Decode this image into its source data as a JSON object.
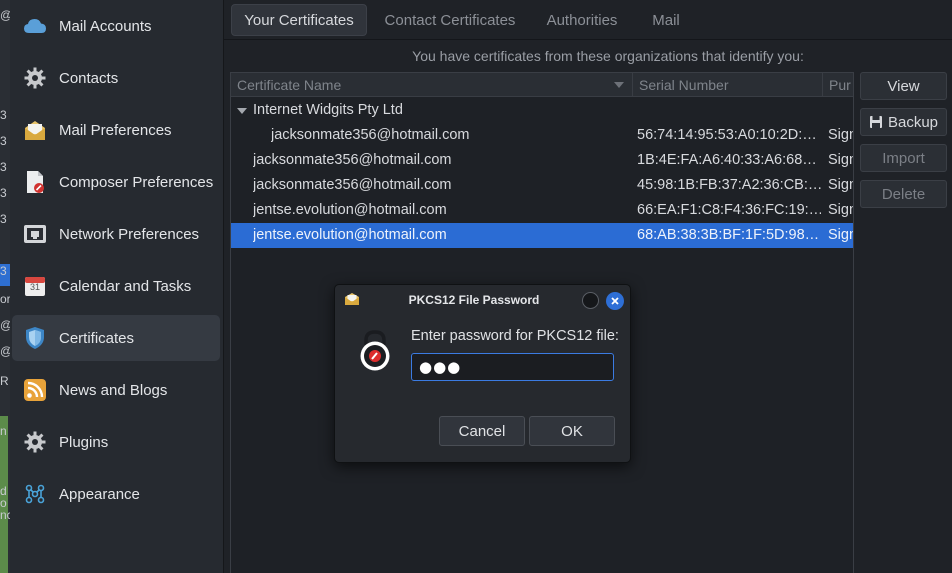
{
  "background_app": {
    "fragments": [
      "@",
      "3",
      "3",
      "3",
      "3",
      "3",
      "3",
      "or",
      "@",
      "@",
      "R",
      "n",
      "d",
      "o",
      "nc"
    ]
  },
  "sidebar": {
    "items": [
      {
        "label": "Mail Accounts",
        "icon": "cloud-icon"
      },
      {
        "label": "Contacts",
        "icon": "gear-icon"
      },
      {
        "label": "Mail Preferences",
        "icon": "envelope-icon"
      },
      {
        "label": "Composer Preferences",
        "icon": "document-edit-icon"
      },
      {
        "label": "Network Preferences",
        "icon": "network-icon"
      },
      {
        "label": "Calendar and Tasks",
        "icon": "calendar-icon",
        "calendar_day": "31"
      },
      {
        "label": "Certificates",
        "icon": "shield-icon",
        "active": true
      },
      {
        "label": "News and Blogs",
        "icon": "rss-icon"
      },
      {
        "label": "Plugins",
        "icon": "gear-icon"
      },
      {
        "label": "Appearance",
        "icon": "appearance-icon"
      }
    ]
  },
  "tabs": [
    {
      "label": "Your Certificates",
      "active": true
    },
    {
      "label": "Contact Certificates"
    },
    {
      "label": "Authorities"
    },
    {
      "label": "Mail"
    }
  ],
  "intro_text": "You have certificates from these organizations that identify you:",
  "table": {
    "columns": [
      "Certificate Name",
      "Serial Number",
      "Pur"
    ],
    "group": "Internet Widgits Pty Ltd",
    "rows": [
      {
        "name": "jacksonmate356@hotmail.com",
        "serial": "56:74:14:95:53:A0:10:2D:…",
        "purpose": "Sign"
      },
      {
        "name": "jacksonmate356@hotmail.com",
        "serial": "1B:4E:FA:A6:40:33:A6:68…",
        "purpose": "Sign"
      },
      {
        "name": "jacksonmate356@hotmail.com",
        "serial": "45:98:1B:FB:37:A2:36:CB:…",
        "purpose": "Sign"
      },
      {
        "name": "jentse.evolution@hotmail.com",
        "serial": "66:EA:F1:C8:F4:36:FC:19:…",
        "purpose": "Sign"
      },
      {
        "name": "jentse.evolution@hotmail.com",
        "serial": "68:AB:38:3B:BF:1F:5D:98…",
        "purpose": "Sign",
        "selected": true
      }
    ]
  },
  "actions": {
    "view": "View",
    "backup": "Backup",
    "import": "Import",
    "delete": "Delete"
  },
  "dialog": {
    "title": "PKCS12 File Password",
    "prompt": "Enter password for PKCS12 file:",
    "password_value": "●●●",
    "cancel": "Cancel",
    "ok": "OK"
  },
  "colors": {
    "selection": "#2b6cd4",
    "accent": "#2e6fd6"
  }
}
